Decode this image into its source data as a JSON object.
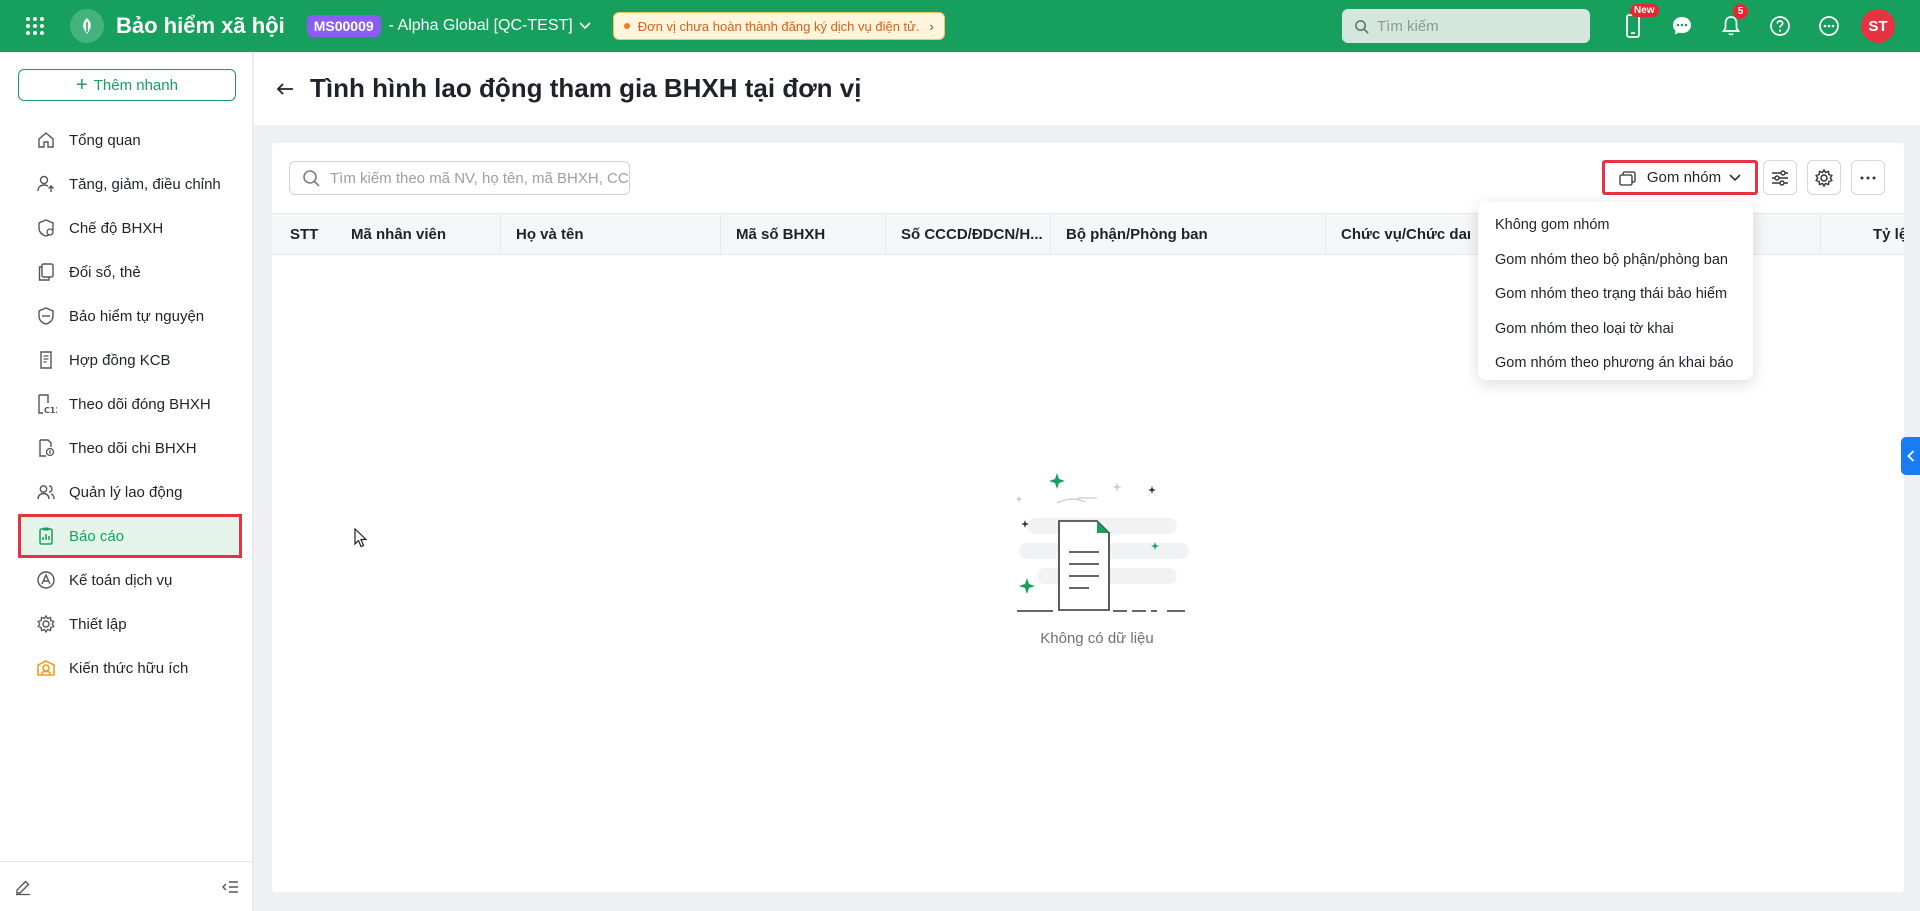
{
  "topbar": {
    "app_title": "Bảo hiểm xã hội",
    "org_code": "MS00009",
    "org_name": "- Alpha Global [QC-TEST]",
    "warning": "Đơn vị chưa hoàn thành đăng ký dịch vụ điện tử.",
    "search_placeholder": "Tìm kiếm",
    "new_badge": "New",
    "notif_count": "5",
    "avatar": "ST",
    "brand_color": "#17a05d"
  },
  "sidebar": {
    "add_label": "Thêm nhanh",
    "items": [
      {
        "label": "Tổng quan",
        "icon": "home-icon"
      },
      {
        "label": "Tăng, giảm, điều chỉnh",
        "icon": "user-up-icon"
      },
      {
        "label": "Chế độ BHXH",
        "icon": "shield-check-icon"
      },
      {
        "label": "Đổi sổ, thẻ",
        "icon": "copy-icon"
      },
      {
        "label": "Bảo hiểm tự nguyện",
        "icon": "shield-icon"
      },
      {
        "label": "Hợp đồng KCB",
        "icon": "contract-icon"
      },
      {
        "label": "Theo dõi đóng BHXH",
        "icon": "c12-icon"
      },
      {
        "label": "Theo dõi chi BHXH",
        "icon": "document-money-icon"
      },
      {
        "label": "Quản lý lao động",
        "icon": "users-icon"
      },
      {
        "label": "Báo cáo",
        "icon": "report-icon",
        "active": true
      },
      {
        "label": "Kế toán dịch vụ",
        "icon": "accounting-icon"
      },
      {
        "label": "Thiết lập",
        "icon": "gear-icon"
      },
      {
        "label": "Kiến thức hữu ích",
        "icon": "knowledge-icon"
      }
    ]
  },
  "header": {
    "title": "Tình hình lao động tham gia BHXH tại đơn vị"
  },
  "toolbar": {
    "search_placeholder": "Tìm kiếm theo mã NV, họ tên, mã BHXH, CCCD",
    "group_label": "Gom nhóm"
  },
  "table": {
    "columns": [
      "STT",
      "Mã nhân viên",
      "Họ và tên",
      "Mã số BHXH",
      "Số CCCD/ĐDCN/H...",
      "Bộ phận/Phòng ban",
      "Chức vụ/Chức danh n",
      "Tỷ lệ"
    ],
    "rows": [],
    "empty_text": "Không có dữ liệu"
  },
  "group_menu": {
    "options": [
      "Không gom nhóm",
      "Gom nhóm theo bộ phận/phòng ban",
      "Gom nhóm theo trạng thái bảo hiểm",
      "Gom nhóm theo loại tờ khai",
      "Gom nhóm theo phương án khai báo"
    ]
  }
}
